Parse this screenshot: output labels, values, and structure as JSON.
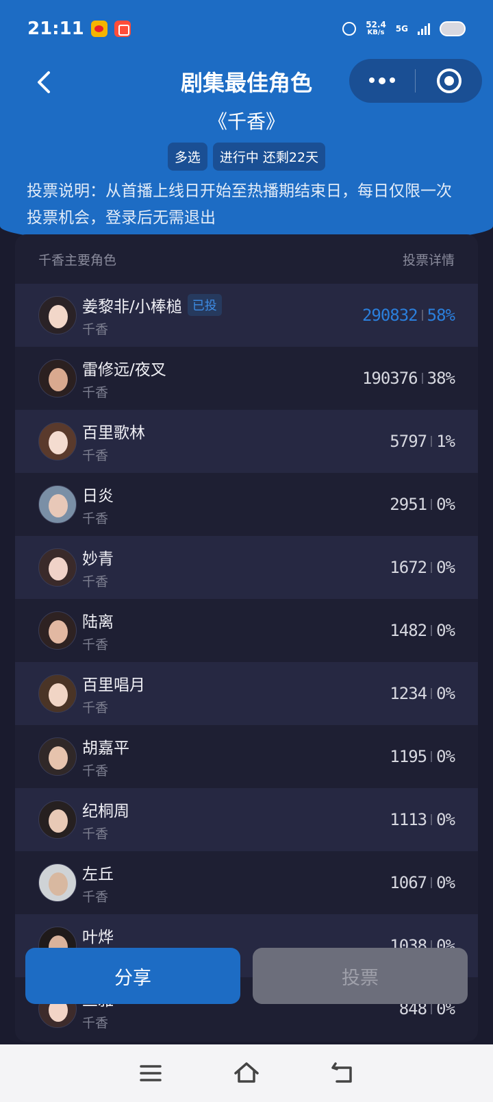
{
  "status_bar": {
    "time": "21:11",
    "net_speed": "52.4",
    "net_unit": "KB/s",
    "network": "5G"
  },
  "header": {
    "title": "剧集最佳角色",
    "subtitle": "《千香》"
  },
  "tags": [
    "多选",
    "进行中 还剩22天"
  ],
  "description": "投票说明：从首播上线日开始至热播期结束日，每日仅限一次投票机会，登录后无需退出",
  "list": {
    "header_left": "千香主要角色",
    "header_right": "投票详情",
    "voted_label": "已投",
    "items": [
      {
        "name": "姜黎非/小棒槌",
        "drama": "千香",
        "votes": "290832",
        "percent": "58%",
        "voted": true
      },
      {
        "name": "雷修远/夜叉",
        "drama": "千香",
        "votes": "190376",
        "percent": "38%"
      },
      {
        "name": "百里歌林",
        "drama": "千香",
        "votes": "5797",
        "percent": "1%"
      },
      {
        "name": "日炎",
        "drama": "千香",
        "votes": "2951",
        "percent": "0%"
      },
      {
        "name": "妙青",
        "drama": "千香",
        "votes": "1672",
        "percent": "0%"
      },
      {
        "name": "陆离",
        "drama": "千香",
        "votes": "1482",
        "percent": "0%"
      },
      {
        "name": "百里唱月",
        "drama": "千香",
        "votes": "1234",
        "percent": "0%"
      },
      {
        "name": "胡嘉平",
        "drama": "千香",
        "votes": "1195",
        "percent": "0%"
      },
      {
        "name": "纪桐周",
        "drama": "千香",
        "votes": "1113",
        "percent": "0%"
      },
      {
        "name": "左丘",
        "drama": "千香",
        "votes": "1067",
        "percent": "0%"
      },
      {
        "name": "叶烨",
        "drama": "千香",
        "votes": "1038",
        "percent": "0%"
      },
      {
        "name": "兰雅",
        "drama": "千香",
        "votes": "848",
        "percent": "0%"
      }
    ]
  },
  "buttons": {
    "share": "分享",
    "vote": "投票"
  },
  "colors": {
    "accent": "#1d6cc4",
    "highlight": "#2b7fdc",
    "background": "#1a1b2e"
  }
}
